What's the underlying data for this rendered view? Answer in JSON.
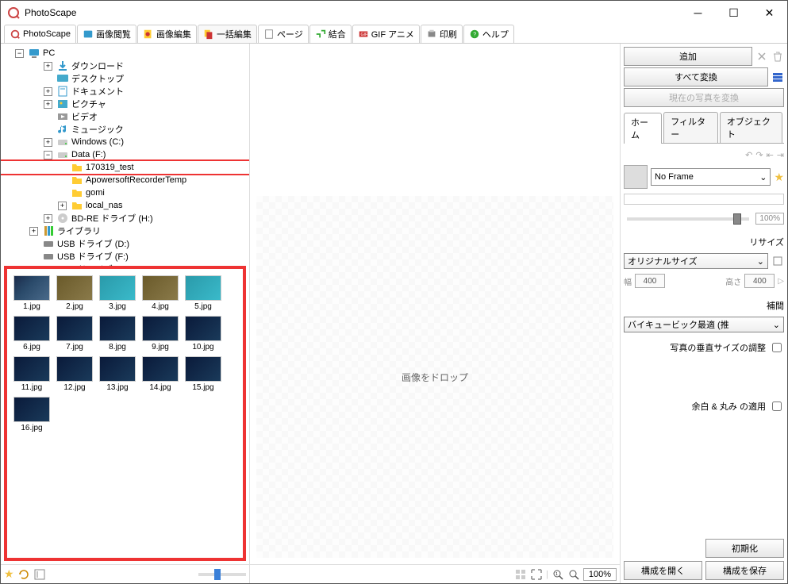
{
  "app_title": "PhotoScape",
  "tabs": [
    "PhotoScape",
    "画像閲覧",
    "画像編集",
    "一括編集",
    "ページ",
    "結合",
    "GIF アニメ",
    "印刷",
    "ヘルプ"
  ],
  "active_tab": 3,
  "tree": {
    "root": "PC",
    "items": [
      {
        "label": "ダウンロード",
        "indent": 2,
        "exp": "+",
        "icon": "dl"
      },
      {
        "label": "デスクトップ",
        "indent": 2,
        "exp": "",
        "icon": "desk"
      },
      {
        "label": "ドキュメント",
        "indent": 2,
        "exp": "+",
        "icon": "doc"
      },
      {
        "label": "ピクチャ",
        "indent": 2,
        "exp": "+",
        "icon": "pic"
      },
      {
        "label": "ビデオ",
        "indent": 2,
        "exp": "",
        "icon": "vid"
      },
      {
        "label": "ミュージック",
        "indent": 2,
        "exp": "",
        "icon": "mus"
      },
      {
        "label": "Windows (C:)",
        "indent": 2,
        "exp": "+",
        "icon": "drv"
      },
      {
        "label": "Data (F:)",
        "indent": 2,
        "exp": "−",
        "icon": "drv"
      },
      {
        "label": "170319_test",
        "indent": 3,
        "exp": "",
        "icon": "fld",
        "selected": true
      },
      {
        "label": "ApowersoftRecorderTemp",
        "indent": 3,
        "exp": "",
        "icon": "fld"
      },
      {
        "label": "gomi",
        "indent": 3,
        "exp": "",
        "icon": "fld"
      },
      {
        "label": "local_nas",
        "indent": 3,
        "exp": "+",
        "icon": "fld"
      },
      {
        "label": "BD-RE ドライブ (H:)",
        "indent": 2,
        "exp": "+",
        "icon": "opt"
      },
      {
        "label": "ライブラリ",
        "indent": 1,
        "exp": "+",
        "icon": "lib"
      },
      {
        "label": "USB ドライブ (D:)",
        "indent": 1,
        "exp": "",
        "icon": "usb"
      },
      {
        "label": "USB ドライブ (F:)",
        "indent": 1,
        "exp": "",
        "icon": "usb"
      },
      {
        "label": "USB ドライブ (G:)",
        "indent": 1,
        "exp": "",
        "icon": "usb"
      }
    ]
  },
  "thumbs": [
    "1.jpg",
    "2.jpg",
    "3.jpg",
    "4.jpg",
    "5.jpg",
    "6.jpg",
    "7.jpg",
    "8.jpg",
    "9.jpg",
    "10.jpg",
    "11.jpg",
    "12.jpg",
    "13.jpg",
    "14.jpg",
    "15.jpg",
    "16.jpg"
  ],
  "drop_text": "画像をドロップ",
  "zoom_pct": "100%",
  "right": {
    "add": "追加",
    "convert_all": "すべて変換",
    "convert_current": "現在の写真を変換",
    "tabs": [
      "ホーム",
      "フィルター",
      "オブジェクト"
    ],
    "active_tab": 0,
    "frame_sel": "No Frame",
    "pct": "100%",
    "resize_label": "リサイズ",
    "size_sel": "オリジナルサイズ",
    "width_label": "幅",
    "width_val": "400",
    "height_label": "高さ",
    "height_val": "400",
    "interp_label": "補間",
    "interp_sel": "バイキュービック最適 (推",
    "vert_adj": "写真の垂直サイズの調整",
    "margin_round": "余白 & 丸み の適用",
    "reset": "初期化",
    "open_config": "構成を開く",
    "save_config": "構成を保存"
  }
}
